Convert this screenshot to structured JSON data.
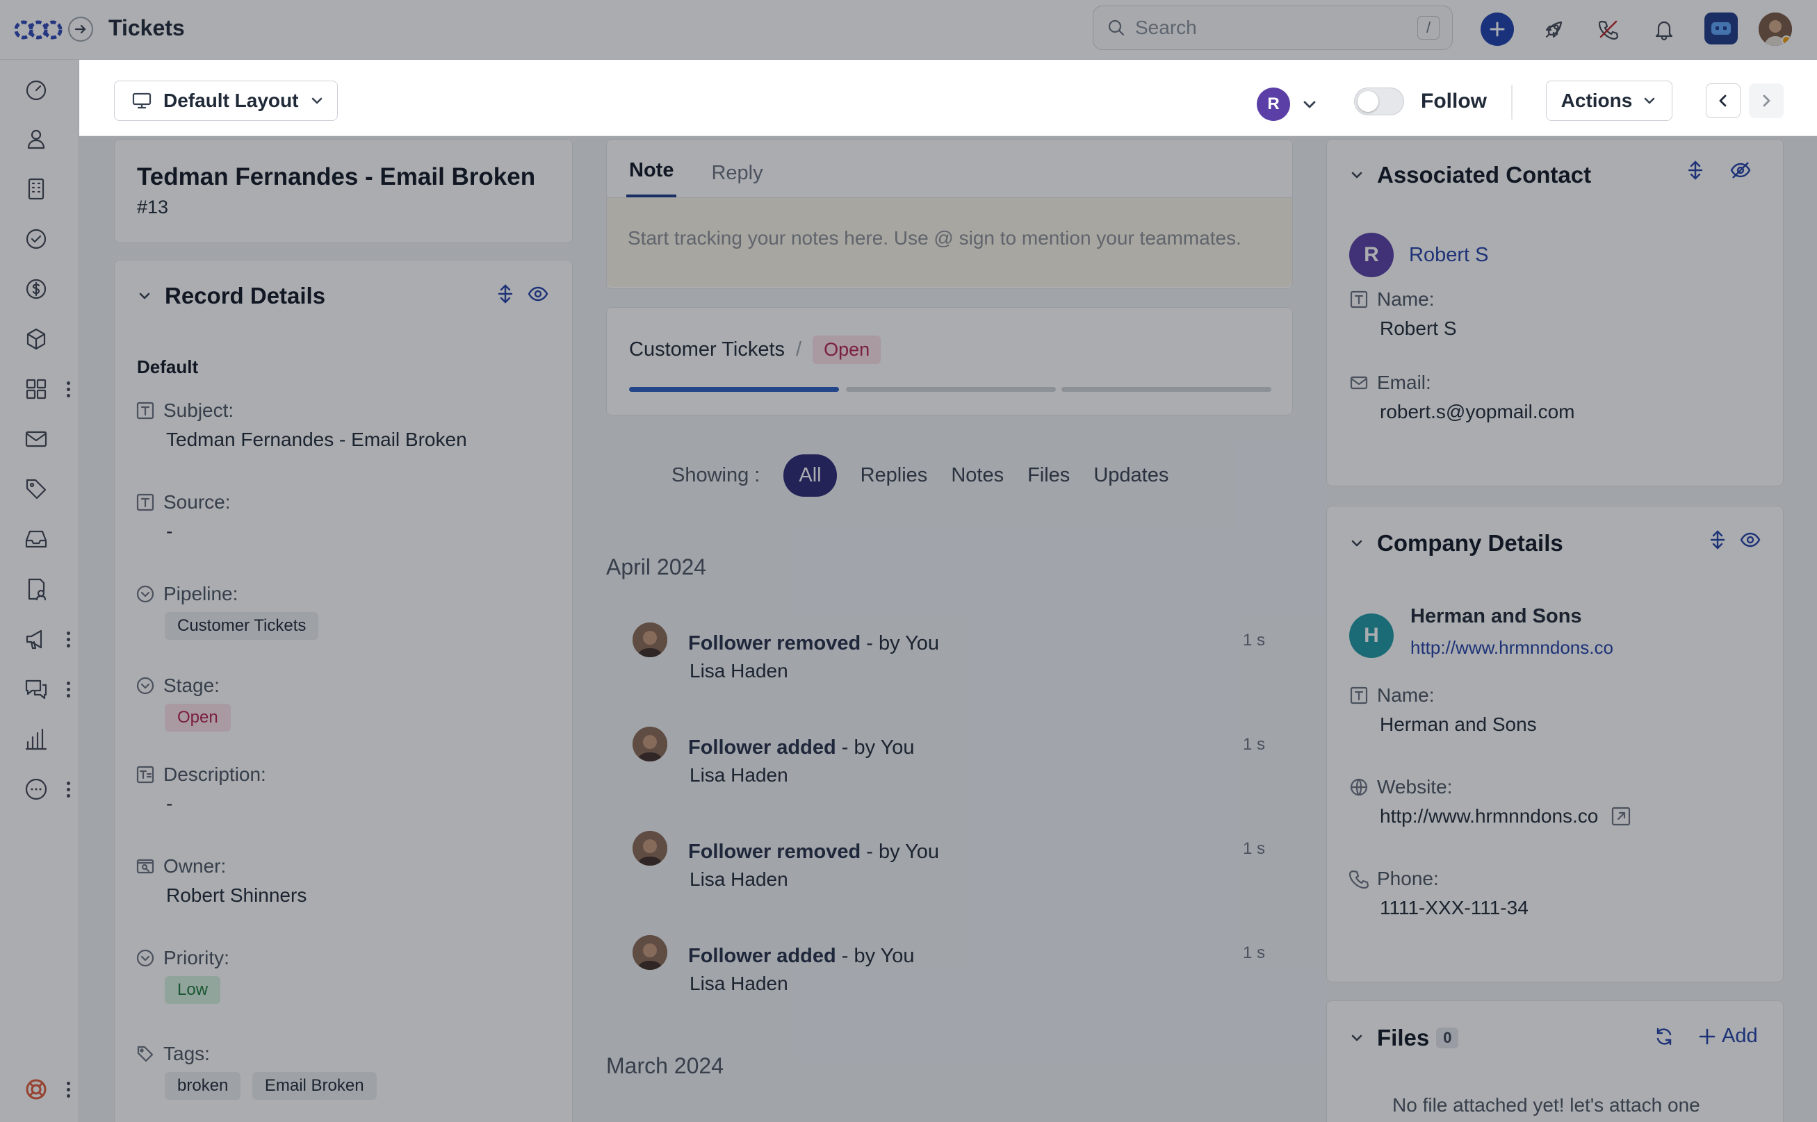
{
  "header": {
    "title": "Tickets",
    "search_placeholder": "Search",
    "search_shortcut": "/"
  },
  "subbar": {
    "layout_label": "Default Layout",
    "assignee_initial": "R",
    "follow_label": "Follow",
    "follow_on": false,
    "actions_label": "Actions"
  },
  "ticket": {
    "title": "Tedman Fernandes - Email Broken",
    "number": "#13"
  },
  "record_details": {
    "title": "Record Details",
    "group": "Default",
    "subject_label": "Subject:",
    "subject": "Tedman Fernandes - Email Broken",
    "source_label": "Source:",
    "source": "-",
    "pipeline_label": "Pipeline:",
    "pipeline": "Customer Tickets",
    "stage_label": "Stage:",
    "stage": "Open",
    "description_label": "Description:",
    "description": "-",
    "owner_label": "Owner:",
    "owner": "Robert Shinners",
    "priority_label": "Priority:",
    "priority": "Low",
    "tags_label": "Tags:",
    "tags": [
      "broken",
      "Email Broken"
    ]
  },
  "composer": {
    "tab_note": "Note",
    "tab_reply": "Reply",
    "placeholder": "Start tracking your notes here. Use @ sign to mention your teammates."
  },
  "pipeline_card": {
    "pipeline": "Customer Tickets",
    "separator": "/",
    "stage": "Open",
    "progress_fraction": 0.333
  },
  "filter": {
    "label": "Showing :",
    "options": [
      "All",
      "Replies",
      "Notes",
      "Files",
      "Updates"
    ],
    "selected": "All"
  },
  "timeline": {
    "month1": "April 2024",
    "items": [
      {
        "action": "Follower removed",
        "by": " - by You",
        "name": "Lisa Haden",
        "time": "1 s"
      },
      {
        "action": "Follower added",
        "by": " - by You",
        "name": "Lisa Haden",
        "time": "1 s"
      },
      {
        "action": "Follower removed",
        "by": " - by You",
        "name": "Lisa Haden",
        "time": "1 s"
      },
      {
        "action": "Follower added",
        "by": " - by You",
        "name": "Lisa Haden",
        "time": "1 s"
      }
    ],
    "month2": "March 2024"
  },
  "contact": {
    "title": "Associated Contact",
    "initial": "R",
    "name_link": "Robert S",
    "name_label": "Name:",
    "name": "Robert S",
    "email_label": "Email:",
    "email": "robert.s@yopmail.com"
  },
  "company": {
    "title": "Company Details",
    "initial": "H",
    "company_name": "Herman and Sons",
    "url": "http://www.hrmnndons.co",
    "name_label": "Name:",
    "name": "Herman and Sons",
    "website_label": "Website:",
    "website": "http://www.hrmnndons.co",
    "phone_label": "Phone:",
    "phone": "1111-XXX-111-34"
  },
  "files": {
    "title": "Files",
    "count": "0",
    "add_label": "Add",
    "empty": "No file attached yet! let's attach one"
  },
  "colors": {
    "accent": "#1e40af",
    "selected_pill": "#2e2a78",
    "open_chip": "#b4234b",
    "low_chip": "#1d7a3c"
  }
}
